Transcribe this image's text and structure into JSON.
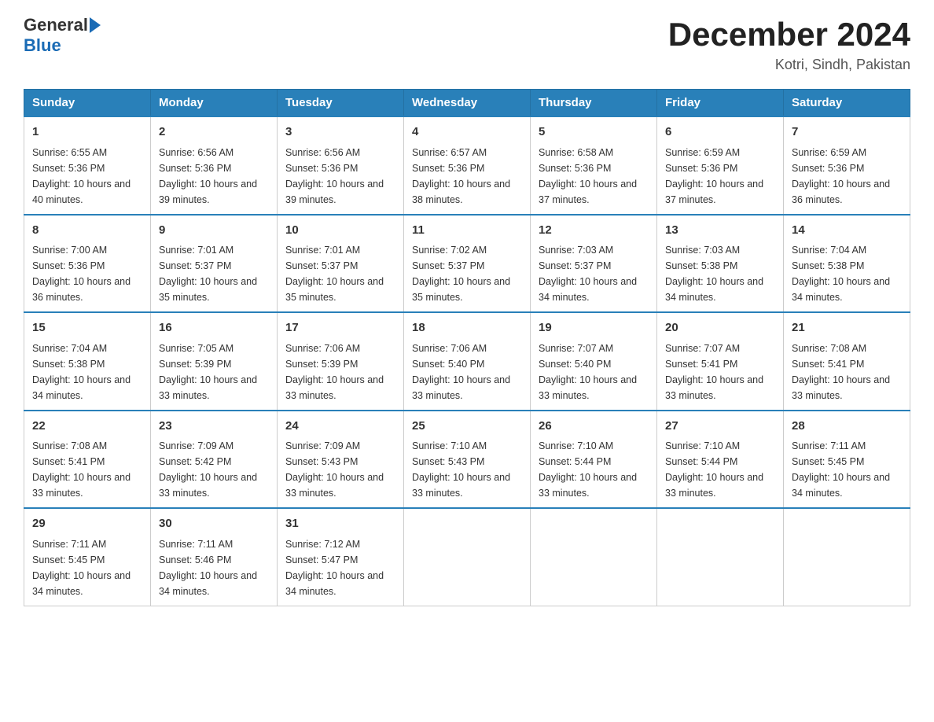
{
  "header": {
    "logo_text_general": "General",
    "logo_text_blue": "Blue",
    "month_title": "December 2024",
    "location": "Kotri, Sindh, Pakistan"
  },
  "days_of_week": [
    "Sunday",
    "Monday",
    "Tuesday",
    "Wednesday",
    "Thursday",
    "Friday",
    "Saturday"
  ],
  "weeks": [
    [
      {
        "day": "1",
        "sunrise": "Sunrise: 6:55 AM",
        "sunset": "Sunset: 5:36 PM",
        "daylight": "Daylight: 10 hours and 40 minutes."
      },
      {
        "day": "2",
        "sunrise": "Sunrise: 6:56 AM",
        "sunset": "Sunset: 5:36 PM",
        "daylight": "Daylight: 10 hours and 39 minutes."
      },
      {
        "day": "3",
        "sunrise": "Sunrise: 6:56 AM",
        "sunset": "Sunset: 5:36 PM",
        "daylight": "Daylight: 10 hours and 39 minutes."
      },
      {
        "day": "4",
        "sunrise": "Sunrise: 6:57 AM",
        "sunset": "Sunset: 5:36 PM",
        "daylight": "Daylight: 10 hours and 38 minutes."
      },
      {
        "day": "5",
        "sunrise": "Sunrise: 6:58 AM",
        "sunset": "Sunset: 5:36 PM",
        "daylight": "Daylight: 10 hours and 37 minutes."
      },
      {
        "day": "6",
        "sunrise": "Sunrise: 6:59 AM",
        "sunset": "Sunset: 5:36 PM",
        "daylight": "Daylight: 10 hours and 37 minutes."
      },
      {
        "day": "7",
        "sunrise": "Sunrise: 6:59 AM",
        "sunset": "Sunset: 5:36 PM",
        "daylight": "Daylight: 10 hours and 36 minutes."
      }
    ],
    [
      {
        "day": "8",
        "sunrise": "Sunrise: 7:00 AM",
        "sunset": "Sunset: 5:36 PM",
        "daylight": "Daylight: 10 hours and 36 minutes."
      },
      {
        "day": "9",
        "sunrise": "Sunrise: 7:01 AM",
        "sunset": "Sunset: 5:37 PM",
        "daylight": "Daylight: 10 hours and 35 minutes."
      },
      {
        "day": "10",
        "sunrise": "Sunrise: 7:01 AM",
        "sunset": "Sunset: 5:37 PM",
        "daylight": "Daylight: 10 hours and 35 minutes."
      },
      {
        "day": "11",
        "sunrise": "Sunrise: 7:02 AM",
        "sunset": "Sunset: 5:37 PM",
        "daylight": "Daylight: 10 hours and 35 minutes."
      },
      {
        "day": "12",
        "sunrise": "Sunrise: 7:03 AM",
        "sunset": "Sunset: 5:37 PM",
        "daylight": "Daylight: 10 hours and 34 minutes."
      },
      {
        "day": "13",
        "sunrise": "Sunrise: 7:03 AM",
        "sunset": "Sunset: 5:38 PM",
        "daylight": "Daylight: 10 hours and 34 minutes."
      },
      {
        "day": "14",
        "sunrise": "Sunrise: 7:04 AM",
        "sunset": "Sunset: 5:38 PM",
        "daylight": "Daylight: 10 hours and 34 minutes."
      }
    ],
    [
      {
        "day": "15",
        "sunrise": "Sunrise: 7:04 AM",
        "sunset": "Sunset: 5:38 PM",
        "daylight": "Daylight: 10 hours and 34 minutes."
      },
      {
        "day": "16",
        "sunrise": "Sunrise: 7:05 AM",
        "sunset": "Sunset: 5:39 PM",
        "daylight": "Daylight: 10 hours and 33 minutes."
      },
      {
        "day": "17",
        "sunrise": "Sunrise: 7:06 AM",
        "sunset": "Sunset: 5:39 PM",
        "daylight": "Daylight: 10 hours and 33 minutes."
      },
      {
        "day": "18",
        "sunrise": "Sunrise: 7:06 AM",
        "sunset": "Sunset: 5:40 PM",
        "daylight": "Daylight: 10 hours and 33 minutes."
      },
      {
        "day": "19",
        "sunrise": "Sunrise: 7:07 AM",
        "sunset": "Sunset: 5:40 PM",
        "daylight": "Daylight: 10 hours and 33 minutes."
      },
      {
        "day": "20",
        "sunrise": "Sunrise: 7:07 AM",
        "sunset": "Sunset: 5:41 PM",
        "daylight": "Daylight: 10 hours and 33 minutes."
      },
      {
        "day": "21",
        "sunrise": "Sunrise: 7:08 AM",
        "sunset": "Sunset: 5:41 PM",
        "daylight": "Daylight: 10 hours and 33 minutes."
      }
    ],
    [
      {
        "day": "22",
        "sunrise": "Sunrise: 7:08 AM",
        "sunset": "Sunset: 5:41 PM",
        "daylight": "Daylight: 10 hours and 33 minutes."
      },
      {
        "day": "23",
        "sunrise": "Sunrise: 7:09 AM",
        "sunset": "Sunset: 5:42 PM",
        "daylight": "Daylight: 10 hours and 33 minutes."
      },
      {
        "day": "24",
        "sunrise": "Sunrise: 7:09 AM",
        "sunset": "Sunset: 5:43 PM",
        "daylight": "Daylight: 10 hours and 33 minutes."
      },
      {
        "day": "25",
        "sunrise": "Sunrise: 7:10 AM",
        "sunset": "Sunset: 5:43 PM",
        "daylight": "Daylight: 10 hours and 33 minutes."
      },
      {
        "day": "26",
        "sunrise": "Sunrise: 7:10 AM",
        "sunset": "Sunset: 5:44 PM",
        "daylight": "Daylight: 10 hours and 33 minutes."
      },
      {
        "day": "27",
        "sunrise": "Sunrise: 7:10 AM",
        "sunset": "Sunset: 5:44 PM",
        "daylight": "Daylight: 10 hours and 33 minutes."
      },
      {
        "day": "28",
        "sunrise": "Sunrise: 7:11 AM",
        "sunset": "Sunset: 5:45 PM",
        "daylight": "Daylight: 10 hours and 34 minutes."
      }
    ],
    [
      {
        "day": "29",
        "sunrise": "Sunrise: 7:11 AM",
        "sunset": "Sunset: 5:45 PM",
        "daylight": "Daylight: 10 hours and 34 minutes."
      },
      {
        "day": "30",
        "sunrise": "Sunrise: 7:11 AM",
        "sunset": "Sunset: 5:46 PM",
        "daylight": "Daylight: 10 hours and 34 minutes."
      },
      {
        "day": "31",
        "sunrise": "Sunrise: 7:12 AM",
        "sunset": "Sunset: 5:47 PM",
        "daylight": "Daylight: 10 hours and 34 minutes."
      },
      null,
      null,
      null,
      null
    ]
  ]
}
